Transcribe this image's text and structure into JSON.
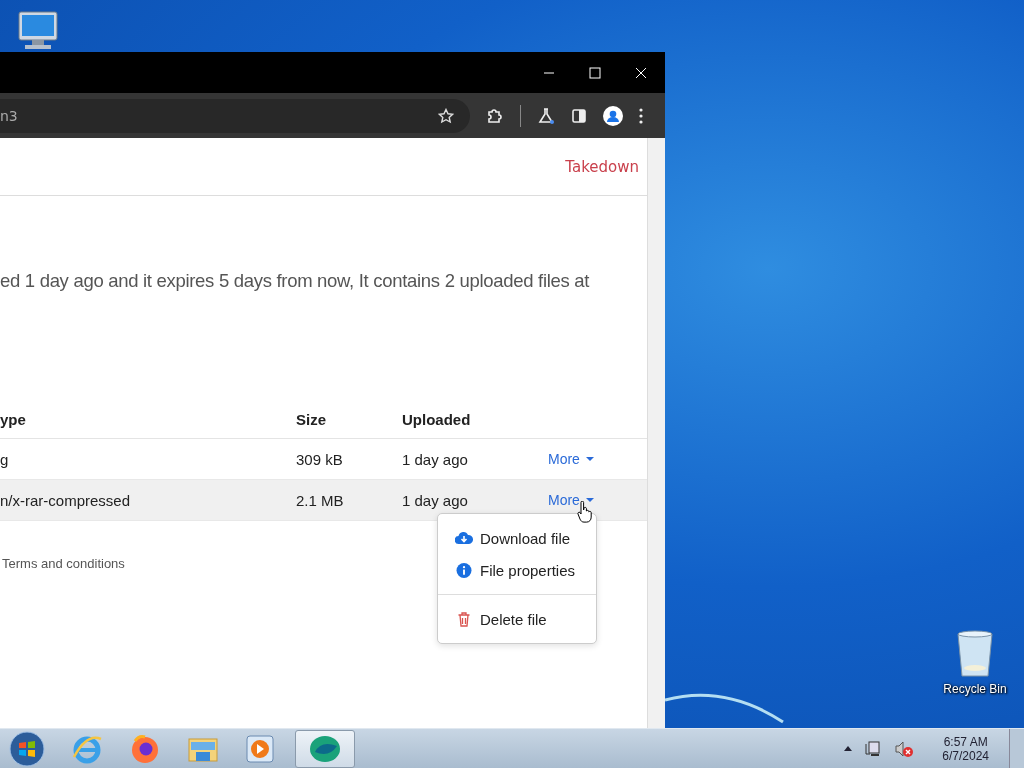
{
  "browser": {
    "address": "n3",
    "header_link": "Takedown",
    "description": "ed 1 day ago and it expires 5 days from now, It contains 2 uploaded files at",
    "table": {
      "columns": [
        "ype",
        "Size",
        "Uploaded"
      ],
      "rows": [
        {
          "type": "g",
          "size": "309 kB",
          "uploaded": "1 day ago",
          "action": "More",
          "hovered": false,
          "expanded": false
        },
        {
          "type": "n/x-rar-compressed",
          "size": "2.1 MB",
          "uploaded": "1 day ago",
          "action": "More",
          "hovered": true,
          "expanded": true
        }
      ]
    },
    "menu": [
      {
        "kind": "download",
        "label": "Download file"
      },
      {
        "kind": "info",
        "label": "File properties"
      },
      {
        "kind": "divider"
      },
      {
        "kind": "delete",
        "label": "Delete file"
      }
    ],
    "footer_link": "Terms and conditions"
  },
  "desktop": {
    "icons": [
      {
        "label": "Recycle Bin"
      }
    ]
  },
  "taskbar": {
    "time": "6:57 AM",
    "date": "6/7/2024"
  }
}
